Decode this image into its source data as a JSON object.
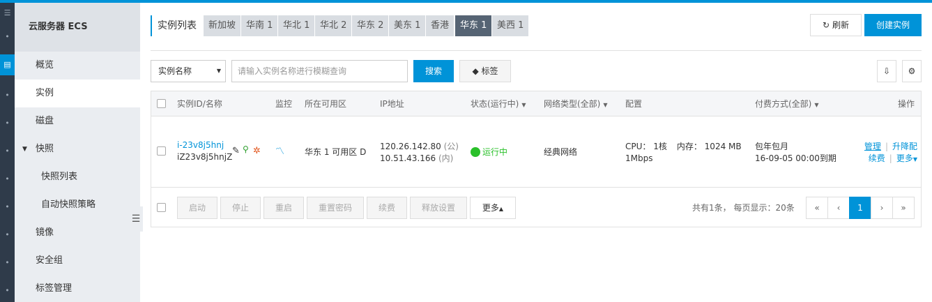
{
  "sidebar": {
    "title": "云服务器 ECS",
    "items": [
      {
        "label": "概览"
      },
      {
        "label": "实例"
      },
      {
        "label": "磁盘"
      },
      {
        "label": "快照"
      },
      {
        "label": "快照列表"
      },
      {
        "label": "自动快照策略"
      },
      {
        "label": "镜像"
      },
      {
        "label": "安全组"
      },
      {
        "label": "标签管理"
      }
    ]
  },
  "header": {
    "title": "实例列表",
    "regions": [
      "新加坡",
      "华南 1",
      "华北 1",
      "华北 2",
      "华东 2",
      "美东 1",
      "香港",
      "华东 1",
      "美西 1"
    ],
    "active_region": "华东 1",
    "refresh_label": "刷新",
    "create_label": "创建实例"
  },
  "search": {
    "field_select": "实例名称",
    "placeholder": "请输入实例名称进行模糊查询",
    "search_label": "搜索",
    "tag_label": "标签"
  },
  "table": {
    "columns": {
      "id_name": "实例ID/名称",
      "monitor": "监控",
      "zone": "所在可用区",
      "ip": "IP地址",
      "status": "状态(运行中)",
      "network": "网络类型(全部)",
      "config": "配置",
      "billing": "付费方式(全部)",
      "actions": "操作"
    },
    "rows": [
      {
        "instance_id": "i-23v8j5hnj",
        "instance_name": "iZ23v8j5hnjZ",
        "zone": "华东 1 可用区 D",
        "ip_public": "120.26.142.80",
        "ip_public_tag": "(公)",
        "ip_private": "10.51.43.166",
        "ip_private_tag": "(内)",
        "status": "运行中",
        "network": "经典网络",
        "cpu": "CPU： 1核",
        "memory": "内存： 1024 MB",
        "bandwidth": "1Mbps",
        "billing_type": "包年包月",
        "expire": "16-09-05 00:00到期",
        "action_manage": "管理",
        "action_upgrade": "升降配",
        "action_renew": "续费",
        "action_more": "更多"
      }
    ]
  },
  "footer": {
    "buttons": [
      "启动",
      "停止",
      "重启",
      "重置密码",
      "续费",
      "释放设置"
    ],
    "more_label": "更多",
    "summary": "共有1条， 每页显示：20条",
    "pager": {
      "first": "«",
      "prev": "‹",
      "current": "1",
      "next": "›",
      "last": "»"
    }
  },
  "colors": {
    "accent": "#0093d8",
    "status_running": "#2ac02a",
    "region_active": "#566474"
  }
}
